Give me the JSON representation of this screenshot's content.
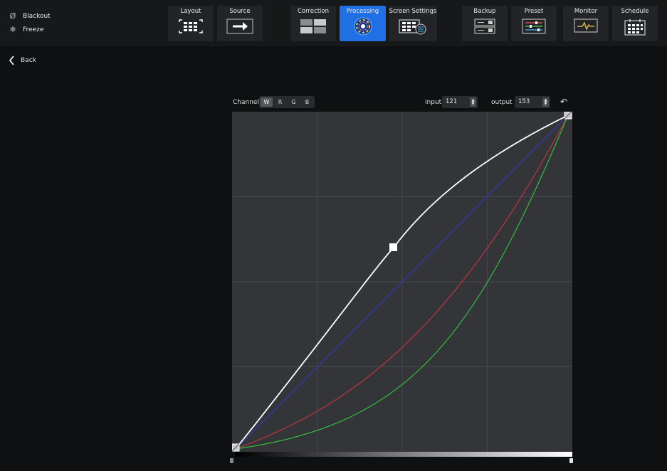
{
  "quick_actions": [
    {
      "label": "Blackout",
      "icon": "blackout-icon"
    },
    {
      "label": "Freeze",
      "icon": "snowflake-icon"
    }
  ],
  "nav": [
    {
      "label": "Layout",
      "icon": "layout-grid-icon",
      "active": false
    },
    {
      "label": "Source",
      "icon": "source-arrow-icon",
      "active": false
    },
    {
      "label": "Correction",
      "icon": "correction-icon",
      "active": false
    },
    {
      "label": "Processing",
      "icon": "processing-wheel-icon",
      "active": true
    },
    {
      "label": "Screen Settings",
      "icon": "screen-settings-icon",
      "active": false
    },
    {
      "label": "Backup",
      "icon": "backup-icon",
      "active": false
    },
    {
      "label": "Preset",
      "icon": "preset-sliders-icon",
      "active": false
    },
    {
      "label": "Monitor",
      "icon": "monitor-pulse-icon",
      "active": false
    },
    {
      "label": "Schedule",
      "icon": "schedule-calendar-icon",
      "active": false
    }
  ],
  "back_label": "Back",
  "curve_editor": {
    "channel_label": "Channel",
    "channels": [
      "W",
      "R",
      "G",
      "B"
    ],
    "active_channel": "W",
    "input_label": "input",
    "input_value": "121",
    "output_label": "output",
    "output_value": "153"
  },
  "colors": {
    "accent": "#1f6fe5",
    "curve_white": "#ffffff",
    "curve_red": "#c0343f",
    "curve_green": "#2fbf3a",
    "curve_blue": "#2b3bb8",
    "chart_bg": "#343539",
    "grid": "#45474c"
  }
}
